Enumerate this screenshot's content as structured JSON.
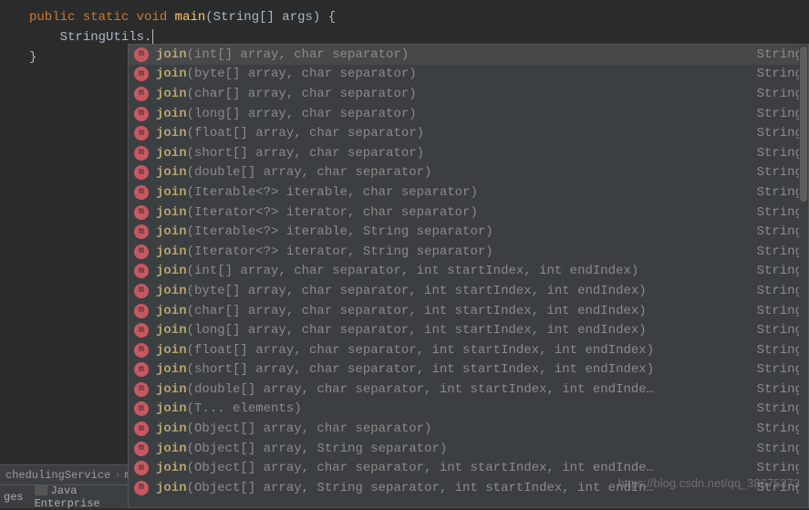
{
  "code": {
    "line1_kw1": "public",
    "line1_kw2": "static",
    "line1_kw3": "void",
    "line1_fn": "main",
    "line1_params": "(String[] args) {",
    "line2": "StringUtils.",
    "line3": "}"
  },
  "popup": {
    "icon_glyph": "m",
    "items": [
      {
        "name": "join",
        "params": "(int[] array, char separator)",
        "ret": "String",
        "selected": true
      },
      {
        "name": "join",
        "params": "(byte[] array, char separator)",
        "ret": "String"
      },
      {
        "name": "join",
        "params": "(char[] array, char separator)",
        "ret": "String"
      },
      {
        "name": "join",
        "params": "(long[] array, char separator)",
        "ret": "String"
      },
      {
        "name": "join",
        "params": "(float[] array, char separator)",
        "ret": "String"
      },
      {
        "name": "join",
        "params": "(short[] array, char separator)",
        "ret": "String"
      },
      {
        "name": "join",
        "params": "(double[] array, char separator)",
        "ret": "String"
      },
      {
        "name": "join",
        "params": "(Iterable<?> iterable, char separator)",
        "ret": "String"
      },
      {
        "name": "join",
        "params": "(Iterator<?> iterator, char separator)",
        "ret": "String"
      },
      {
        "name": "join",
        "params": "(Iterable<?> iterable, String separator)",
        "ret": "String"
      },
      {
        "name": "join",
        "params": "(Iterator<?> iterator, String separator)",
        "ret": "String"
      },
      {
        "name": "join",
        "params": "(int[] array, char separator, int startIndex, int endIndex)",
        "ret": "String"
      },
      {
        "name": "join",
        "params": "(byte[] array, char separator, int startIndex, int endIndex)",
        "ret": "String"
      },
      {
        "name": "join",
        "params": "(char[] array, char separator, int startIndex, int endIndex)",
        "ret": "String"
      },
      {
        "name": "join",
        "params": "(long[] array, char separator, int startIndex, int endIndex)",
        "ret": "String"
      },
      {
        "name": "join",
        "params": "(float[] array, char separator, int startIndex, int endIndex)",
        "ret": "String"
      },
      {
        "name": "join",
        "params": "(short[] array, char separator, int startIndex, int endIndex)",
        "ret": "String"
      },
      {
        "name": "join",
        "params": "(double[] array, char separator, int startIndex, int endInde…",
        "ret": "String"
      },
      {
        "name": "join",
        "params": "(T... elements)",
        "ret": "String"
      },
      {
        "name": "join",
        "params": "(Object[] array, char separator)",
        "ret": "String"
      },
      {
        "name": "join",
        "params": "(Object[] array, String separator)",
        "ret": "String"
      },
      {
        "name": "join",
        "params": "(Object[] array, char separator, int startIndex, int endInde…",
        "ret": "String"
      },
      {
        "name": "join",
        "params": "(Object[] array, String separator, int startIndex, int endIn…",
        "ret": "String"
      }
    ]
  },
  "breadcrumb": {
    "part1": "chedulingService",
    "sep": "›",
    "part2": "main"
  },
  "bottom": {
    "tab1": "ges",
    "tab2": "Java Enterprise"
  },
  "watermark": "https://blog.csdn.net/qq_38675373"
}
